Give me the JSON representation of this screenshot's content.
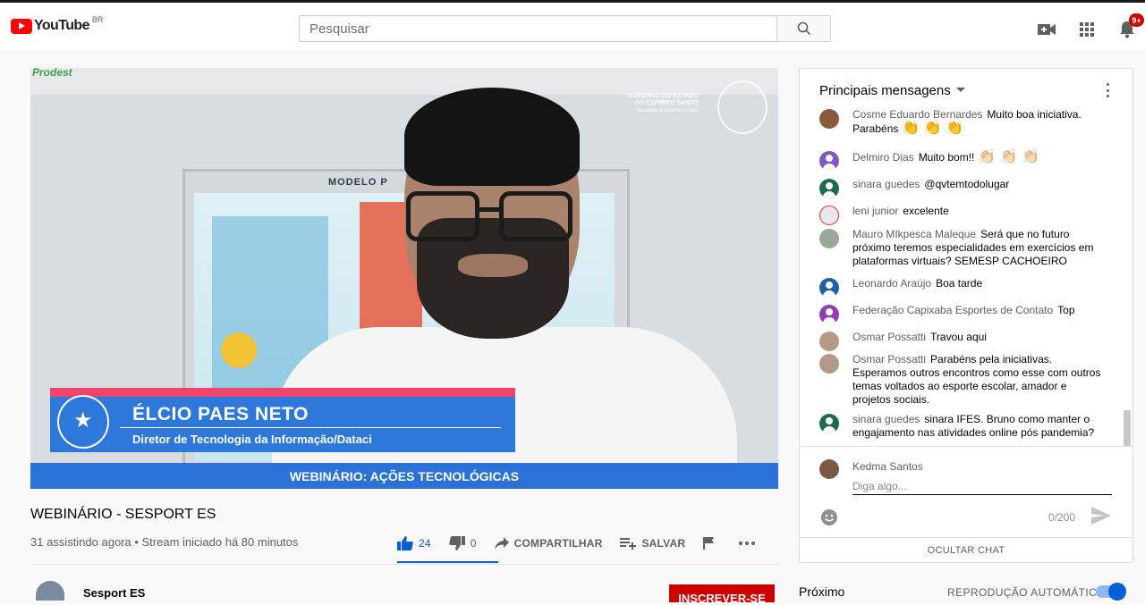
{
  "header": {
    "logo_text": "YouTube",
    "country_code": "BR",
    "search_placeholder": "Pesquisar",
    "notification_count": "9+"
  },
  "video": {
    "overlay_brand": "Prodest",
    "overlay_gov_line1": "GOVERNO DO ESTADO",
    "overlay_gov_line2": "DO ESPÍRITO SANTO",
    "overlay_gov_line3": "Secretaria de Esportes e Lazer",
    "board_title": "MODELO P",
    "lower_third_name": "ÉLCIO PAES NETO",
    "lower_third_role": "Diretor de Tecnologia da Informação/Dataci",
    "banner_text": "WEBINÁRIO: AÇÕES TECNOLÓGICAS"
  },
  "info": {
    "title": "WEBINÁRIO - SESPORT ES",
    "meta": "31 assistindo agora • Stream iniciado há 80 minutos",
    "likes": "24",
    "dislikes": "0",
    "share_label": "COMPARTILHAR",
    "save_label": "SALVAR"
  },
  "channel": {
    "name": "Sesport ES",
    "subscribe_label": "INSCREVER-SE"
  },
  "chat": {
    "header_title": "Principais mensagens",
    "messages": [
      {
        "author": "Cosme Eduardo Bernardes",
        "text": "Muito boa iniciativa. Parabéns",
        "emoji": "👏 👏 👏",
        "avatar_color": "#8a5a3c"
      },
      {
        "author": "Delmiro Dias",
        "text": "Muito bom!!",
        "emoji": "👏🏻 👏🏻 👏🏻",
        "avatar_color": "#7e57c2"
      },
      {
        "author": "sinara guedes",
        "text": "@qvtemtodolugar",
        "emoji": "",
        "avatar_color": "#1e6a4e"
      },
      {
        "author": "leni junior",
        "text": "excelente",
        "emoji": "",
        "avatar_color": "#e8e8f0"
      },
      {
        "author": "Mauro MIkpesca Maleque",
        "text": "Será que no futuro próximo teremos especialidades em exercícios em plataformas virtuais? SEMESP CACHOEIRO",
        "emoji": "",
        "avatar_color": "#9aa89a"
      },
      {
        "author": "Leonardo Araújo",
        "text": "Boa tarde",
        "emoji": "",
        "avatar_color": "#1f5fa8"
      },
      {
        "author": "Federação Capixaba Esportes de Contato",
        "text": "Top",
        "emoji": "",
        "avatar_color": "#8e3fb0"
      },
      {
        "author": "Osmar Possatti",
        "text": "Travou aqui",
        "emoji": "",
        "avatar_color": "#b49a86"
      },
      {
        "author": "Osmar Possatti",
        "text": "Parabéns pela iniciativas. Esperamos outros encontros como esse com outros temas voltados ao esporte escolar, amador e projetos sociais.",
        "emoji": "",
        "avatar_color": "#b49a86"
      },
      {
        "author": "sinara guedes",
        "text": "sinara IFES. Bruno como manter o engajamento nas atividades online pós pandemia?",
        "emoji": "",
        "avatar_color": "#1e6a4e"
      }
    ],
    "input_author": "Kedma Santos",
    "input_placeholder": "Diga algo...",
    "char_counter": "0/200",
    "hide_chat_label": "OCULTAR CHAT"
  },
  "sidebar": {
    "next_label": "Próximo",
    "autoplay_label": "REPRODUÇÃO AUTOMÁTICA",
    "autoplay_on": true
  },
  "colors": {
    "brand_red": "#ff0000",
    "link_blue": "#065fd4",
    "lower_third_blue": "#2f78db",
    "lower_third_pink": "#f0456a"
  }
}
